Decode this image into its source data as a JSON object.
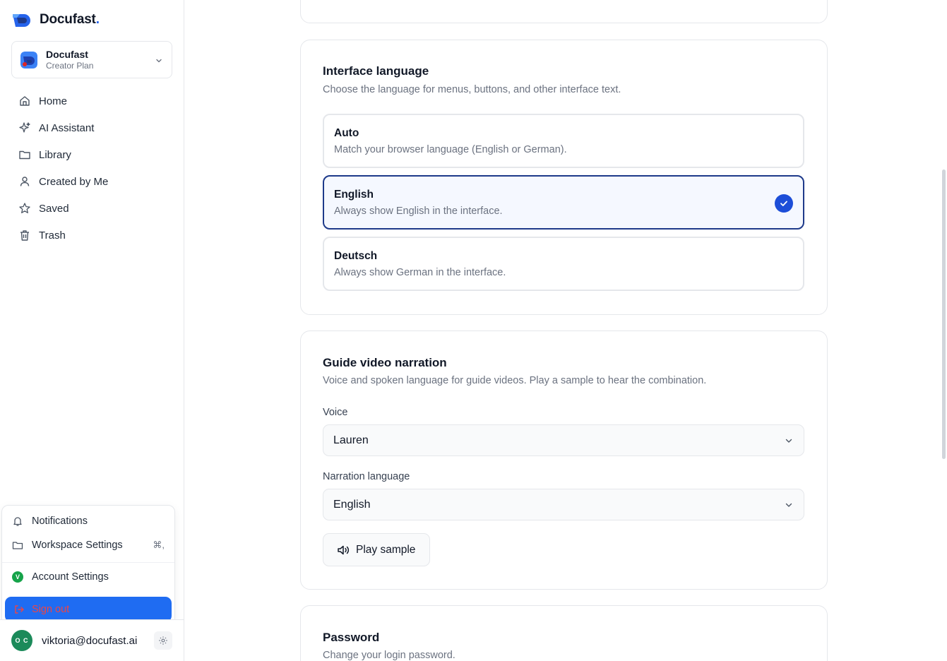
{
  "brand": {
    "name": "Docufast",
    "dot": "."
  },
  "workspace": {
    "name": "Docufast",
    "plan": "Creator Plan"
  },
  "nav": {
    "items": [
      {
        "label": "Home",
        "icon": "home-icon"
      },
      {
        "label": "AI Assistant",
        "icon": "sparkle-icon"
      },
      {
        "label": "Library",
        "icon": "folder-icon"
      },
      {
        "label": "Created by Me",
        "icon": "user-icon"
      },
      {
        "label": "Saved",
        "icon": "star-icon"
      },
      {
        "label": "Trash",
        "icon": "trash-icon"
      }
    ]
  },
  "menu": {
    "notifications": "Notifications",
    "workspace_settings": "Workspace Settings",
    "workspace_settings_shortcut": "⌘,",
    "account_settings": "Account Settings",
    "account_badge": "V",
    "sign_out": "Sign out"
  },
  "user": {
    "email": "viktoria@docufast.ai",
    "initials": "O C"
  },
  "interface_language": {
    "title": "Interface language",
    "subtitle": "Choose the language for menus, buttons, and other interface text.",
    "options": [
      {
        "title": "Auto",
        "desc": "Match your browser language (English or German)."
      },
      {
        "title": "English",
        "desc": "Always show English in the interface."
      },
      {
        "title": "Deutsch",
        "desc": "Always show German in the interface."
      }
    ],
    "selected": "English"
  },
  "narration": {
    "title": "Guide video narration",
    "subtitle": "Voice and spoken language for guide videos. Play a sample to hear the combination.",
    "voice_label": "Voice",
    "voice_value": "Lauren",
    "language_label": "Narration language",
    "language_value": "English",
    "play_label": "Play sample"
  },
  "password": {
    "title": "Password",
    "subtitle": "Change your login password."
  },
  "colors": {
    "accent": "#1d4ed8",
    "signout_bg": "#1f6cf2",
    "signout_text": "#ef4444",
    "avatar": "#1b8a5a"
  }
}
